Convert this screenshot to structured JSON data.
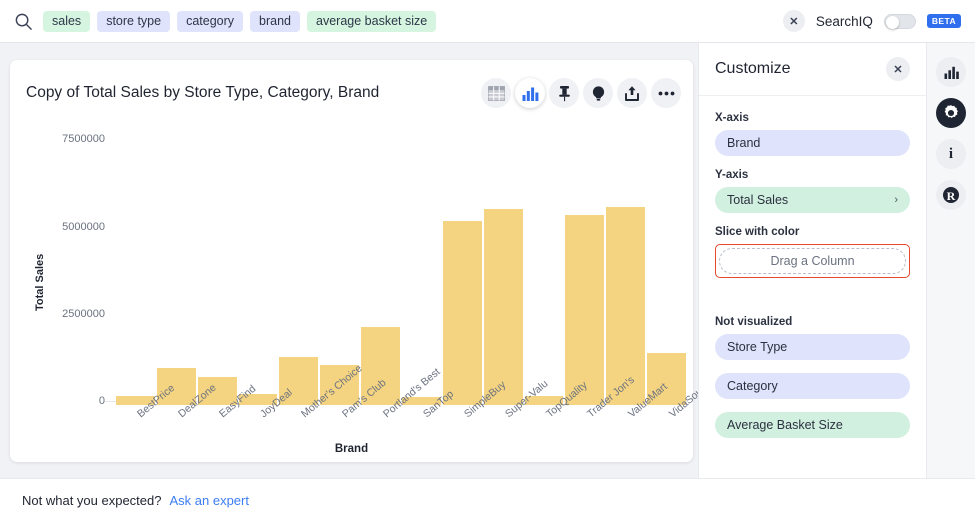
{
  "search": {
    "icon": "search-icon",
    "chips": [
      {
        "label": "sales",
        "kind": "measure"
      },
      {
        "label": "store type",
        "kind": "attr"
      },
      {
        "label": "category",
        "kind": "attr"
      },
      {
        "label": "brand",
        "kind": "attr"
      },
      {
        "label": "average basket size",
        "kind": "measure"
      }
    ],
    "clear_label": "✕",
    "searchiq_label": "SearchIQ",
    "searchiq_enabled": false,
    "beta_label": "BETA"
  },
  "chart_card": {
    "title": "Copy of Total Sales by Store Type, Category, Brand",
    "tools": [
      {
        "name": "table-view-icon",
        "label": "Table"
      },
      {
        "name": "chart-view-icon",
        "label": "Chart",
        "active": true
      },
      {
        "name": "pin-icon",
        "label": "Pin"
      },
      {
        "name": "insights-lightbulb-icon",
        "label": "Insights"
      },
      {
        "name": "share-icon",
        "label": "Share"
      },
      {
        "name": "more-options-icon",
        "label": "More"
      }
    ]
  },
  "chart_data": {
    "type": "bar",
    "title": "Copy of Total Sales by Store Type, Category, Brand",
    "xlabel": "Brand",
    "ylabel": "Total Sales",
    "categories": [
      "BestPrice",
      "DealZone",
      "EasyFind",
      "JoyDeal",
      "Mother's Choice",
      "Pam's Club",
      "Portland's Best",
      "SanTop",
      "SimpleBuy",
      "Super-Valu",
      "TopQuality",
      "Trader Jon's",
      "ValueMart",
      "VidaSource"
    ],
    "values": [
      250000,
      1050000,
      800000,
      330000,
      1380000,
      1160000,
      2230000,
      220000,
      5280000,
      5630000,
      260000,
      5450000,
      5670000,
      1480000
    ],
    "yticks": [
      7500000,
      5000000,
      2500000,
      0
    ],
    "ylim": [
      0,
      8200000
    ],
    "bar_color": "#f5d481",
    "grid": false,
    "legend": false
  },
  "panel": {
    "title": "Customize",
    "close_label": "✕",
    "xaxis": {
      "label": "X-axis",
      "value": "Brand",
      "kind": "attr"
    },
    "yaxis": {
      "label": "Y-axis",
      "value": "Total Sales",
      "kind": "measure",
      "chevron": "›"
    },
    "slice": {
      "label": "Slice with color",
      "placeholder": "Drag a Column",
      "highlight_color": "#e8472a"
    },
    "not_visualized": {
      "label": "Not visualized",
      "items": [
        {
          "label": "Store Type",
          "kind": "attr"
        },
        {
          "label": "Category",
          "kind": "attr"
        },
        {
          "label": "Average Basket Size",
          "kind": "measure"
        }
      ]
    }
  },
  "rail": {
    "items": [
      {
        "name": "chart-icon",
        "active": false
      },
      {
        "name": "settings-gear-icon",
        "active": true
      },
      {
        "name": "info-icon",
        "active": false,
        "glyph": "i"
      },
      {
        "name": "r-analysis-icon",
        "active": false,
        "glyph": "R"
      }
    ]
  },
  "footer": {
    "text": "Not what you expected?",
    "link": "Ask an expert"
  }
}
